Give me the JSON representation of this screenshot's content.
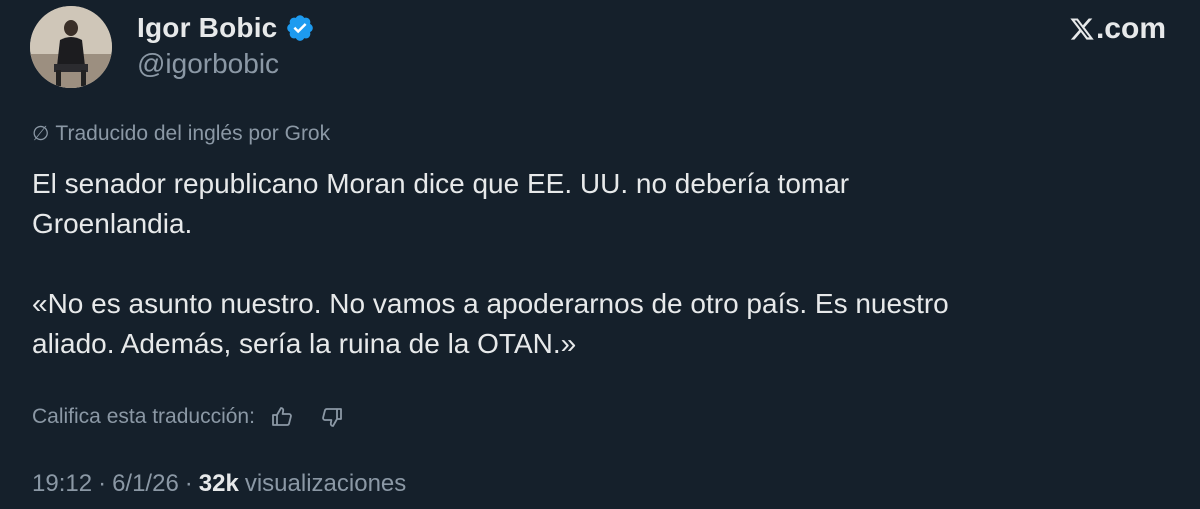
{
  "author": {
    "display_name": "Igor Bobic",
    "handle": "@igorbobic",
    "verified": true
  },
  "brand": {
    "label": ".com",
    "logo_icon": "x-logo-icon"
  },
  "translation": {
    "icon": "no-symbol-icon",
    "note": "Traducido del inglés por Grok"
  },
  "tweet": {
    "text": "El senador republicano Moran dice que EE. UU. no debería tomar\nGroenlandia.\n\n«No es asunto nuestro. No vamos a apoderarnos de otro país. Es nuestro\naliado. Además, sería la ruina de la OTAN.»"
  },
  "rating": {
    "label": "Califica esta traducción:",
    "thumbs_up_icon": "thumbs-up-icon",
    "thumbs_down_icon": "thumbs-down-icon"
  },
  "meta": {
    "time": "19:12",
    "date": "6/1/26",
    "views_count": "32k",
    "views_label": "visualizaciones",
    "separator": "·"
  },
  "colors": {
    "background": "#15202b",
    "text": "#e7e9ea",
    "secondary_text": "#8b98a5",
    "verified_badge": "#1d9bf0"
  }
}
